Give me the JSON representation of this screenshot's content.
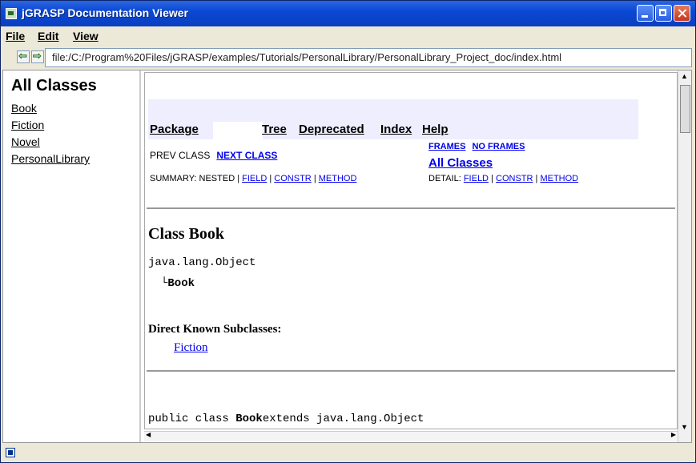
{
  "window": {
    "title": "jGRASP Documentation Viewer"
  },
  "menu": {
    "items": [
      "File",
      "Edit",
      "View"
    ]
  },
  "address": {
    "url": "file:/C:/Program%20Files/jGRASP/examples/Tutorials/PersonalLibrary/PersonalLibrary_Project_doc/index.html"
  },
  "left": {
    "heading": "All Classes",
    "links": [
      "Book",
      "Fiction",
      "Novel",
      "PersonalLibrary"
    ]
  },
  "nav": {
    "tabs": [
      "Package",
      "Tree",
      "Deprecated",
      "Index",
      "Help"
    ],
    "prev_class": "PREV CLASS",
    "next_class": "NEXT CLASS",
    "frames": "FRAMES",
    "no_frames": "NO FRAMES",
    "all_classes": "All Classes",
    "summary_label": "SUMMARY: NESTED |",
    "detail_label": "DETAIL:",
    "field": "FIELD",
    "constr": "CONSTR",
    "method": "METHOD",
    "sep": "|"
  },
  "doc": {
    "class_title": "Class Book",
    "object_line": "java.lang.Object",
    "inherit_glyph": "└",
    "inherit_class": "Book",
    "dks_heading": "Direct Known Subclasses:",
    "dks_link": "Fiction",
    "decl_prefix": "public class ",
    "decl_class": "Book",
    "decl_suffix": "extends java.lang.Object"
  },
  "icons": [
    "app-icon",
    "back-arrow-icon",
    "forward-arrow-icon",
    "minimize-icon",
    "maximize-icon",
    "close-icon",
    "status-icon"
  ]
}
